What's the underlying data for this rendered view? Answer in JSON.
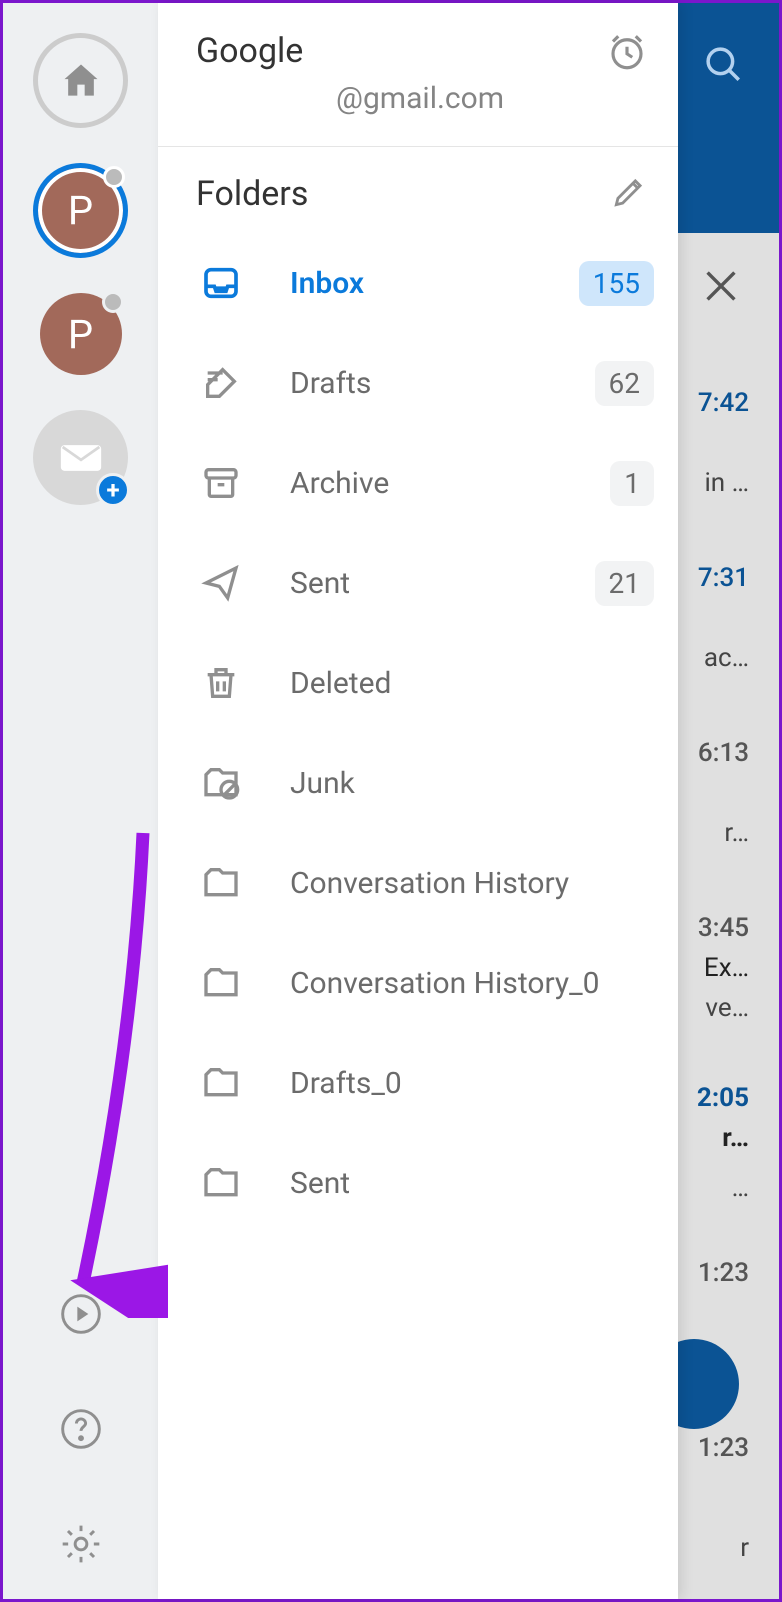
{
  "account": {
    "name": "Google",
    "email": "@gmail.com"
  },
  "rail": {
    "avatar1_letter": "P",
    "avatar2_letter": "P"
  },
  "sections": {
    "folders": "Folders"
  },
  "folders": [
    {
      "icon": "inbox",
      "label": "Inbox",
      "count": "155",
      "active": true
    },
    {
      "icon": "drafts",
      "label": "Drafts",
      "count": "62"
    },
    {
      "icon": "archive",
      "label": "Archive",
      "count": "1"
    },
    {
      "icon": "sent",
      "label": "Sent",
      "count": "21"
    },
    {
      "icon": "deleted",
      "label": "Deleted"
    },
    {
      "icon": "junk",
      "label": "Junk"
    },
    {
      "icon": "folder",
      "label": "Conversation History"
    },
    {
      "icon": "folder",
      "label": "Conversation History_0"
    },
    {
      "icon": "folder",
      "label": "Drafts_0"
    },
    {
      "icon": "folder",
      "label": "Sent"
    }
  ],
  "background": {
    "times": [
      "7:42",
      "7:31",
      "6:13",
      "3:45",
      "2:05",
      "1:23",
      "1:23"
    ],
    "snips": [
      "in …",
      "ac…",
      "r…",
      "Ex…",
      "ve…",
      "r…",
      "…",
      "r"
    ]
  }
}
